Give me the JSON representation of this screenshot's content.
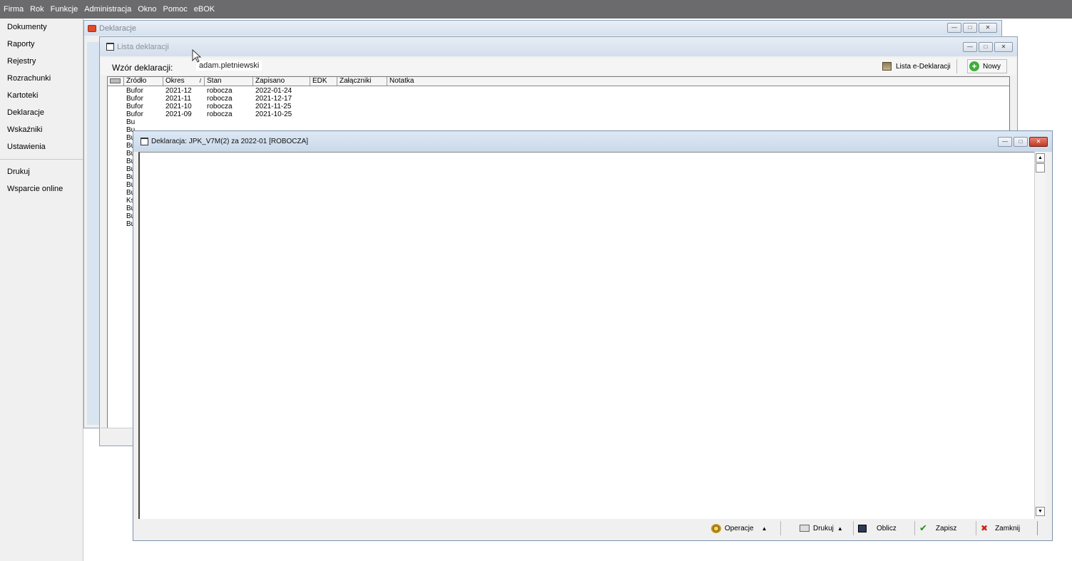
{
  "menu": [
    "Firma",
    "Rok",
    "Funkcje",
    "Administracja",
    "Okno",
    "Pomoc",
    "eBOK"
  ],
  "sidebar": {
    "items": [
      "Dokumenty",
      "Raporty",
      "Rejestry",
      "Rozrachunki",
      "Kartoteki",
      "Deklaracje",
      "Wskaźniki",
      "Ustawienia"
    ],
    "items2": [
      "Drukuj",
      "Wsparcie online"
    ]
  },
  "win_deklaracje": {
    "title": "Deklaracje"
  },
  "win_lista": {
    "title": "Lista deklaracji",
    "wzor_label": "Wzór deklaracji:",
    "tooltip": "adam.pletniewski",
    "btn_e": "Lista e-Deklaracji",
    "btn_nowy": "Nowy",
    "columns": [
      "Źródło",
      "Okres",
      "Stan",
      "Zapisano",
      "EDK",
      "Załączniki",
      "Notatka"
    ],
    "rows": [
      [
        "Bufor",
        "2021-12",
        "robocza",
        "2022-01-24"
      ],
      [
        "Bufor",
        "2021-11",
        "robocza",
        "2021-12-17"
      ],
      [
        "Bufor",
        "2021-10",
        "robocza",
        "2021-11-25"
      ],
      [
        "Bufor",
        "2021-09",
        "robocza",
        "2021-10-25"
      ]
    ],
    "partial_rows": [
      "Bu",
      "Bu",
      "Bu",
      "Bu",
      "Bu",
      "Bu",
      "Bu",
      "Bu",
      "Bu",
      "Bu",
      "Ks",
      "Bu",
      "Bu",
      "Bu"
    ]
  },
  "win_dekl": {
    "title": "Deklaracja: JPK_V7M(2) za 2022-01  [ROBOCZA]",
    "btn_operacje": "Operacje",
    "btn_drukuj": "Drukuj",
    "btn_oblicz": "Oblicz",
    "btn_zapisz": "Zapisz",
    "btn_zamknij": "Zamknij"
  }
}
